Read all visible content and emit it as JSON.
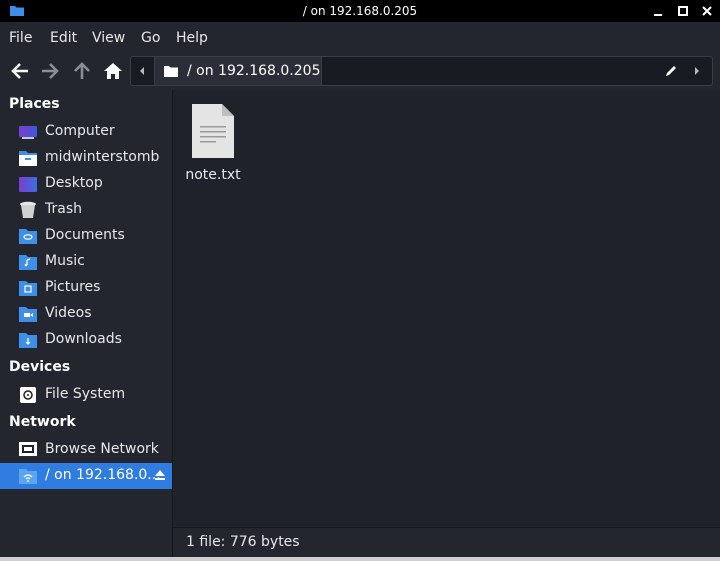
{
  "window": {
    "title": "/ on 192.168.0.205",
    "controls": [
      "minimize-icon",
      "maximize-icon",
      "close-icon"
    ]
  },
  "menubar": {
    "items": [
      "File",
      "Edit",
      "View",
      "Go",
      "Help"
    ]
  },
  "toolbar": {
    "buttons": [
      "back-arrow-icon",
      "forward-arrow-icon",
      "up-arrow-icon",
      "home-icon"
    ],
    "path_segment": "/ on 192.168.0.205"
  },
  "sidebar": {
    "sections": [
      {
        "heading": "Places",
        "items": [
          {
            "label": "Computer",
            "icon": "computer-icon"
          },
          {
            "label": "midwinterstomb",
            "icon": "home-folder-icon"
          },
          {
            "label": "Desktop",
            "icon": "desktop-icon"
          },
          {
            "label": "Trash",
            "icon": "trash-icon"
          },
          {
            "label": "Documents",
            "icon": "documents-folder-icon"
          },
          {
            "label": "Music",
            "icon": "music-folder-icon"
          },
          {
            "label": "Pictures",
            "icon": "pictures-folder-icon"
          },
          {
            "label": "Videos",
            "icon": "videos-folder-icon"
          },
          {
            "label": "Downloads",
            "icon": "downloads-folder-icon"
          }
        ]
      },
      {
        "heading": "Devices",
        "items": [
          {
            "label": "File System",
            "icon": "drive-icon"
          }
        ]
      },
      {
        "heading": "Network",
        "items": [
          {
            "label": "Browse Network",
            "icon": "network-icon"
          },
          {
            "label": "/ on 192.168.0...",
            "icon": "network-share-icon",
            "selected": true
          }
        ]
      }
    ]
  },
  "files": [
    {
      "name": "note.txt",
      "icon": "text-file-icon"
    }
  ],
  "status": "1 file: 776 bytes",
  "colors": {
    "accent": "#2f7de1",
    "folder": "#3d8fe8",
    "background": "#1f222b",
    "sidebar": "#23262f"
  }
}
